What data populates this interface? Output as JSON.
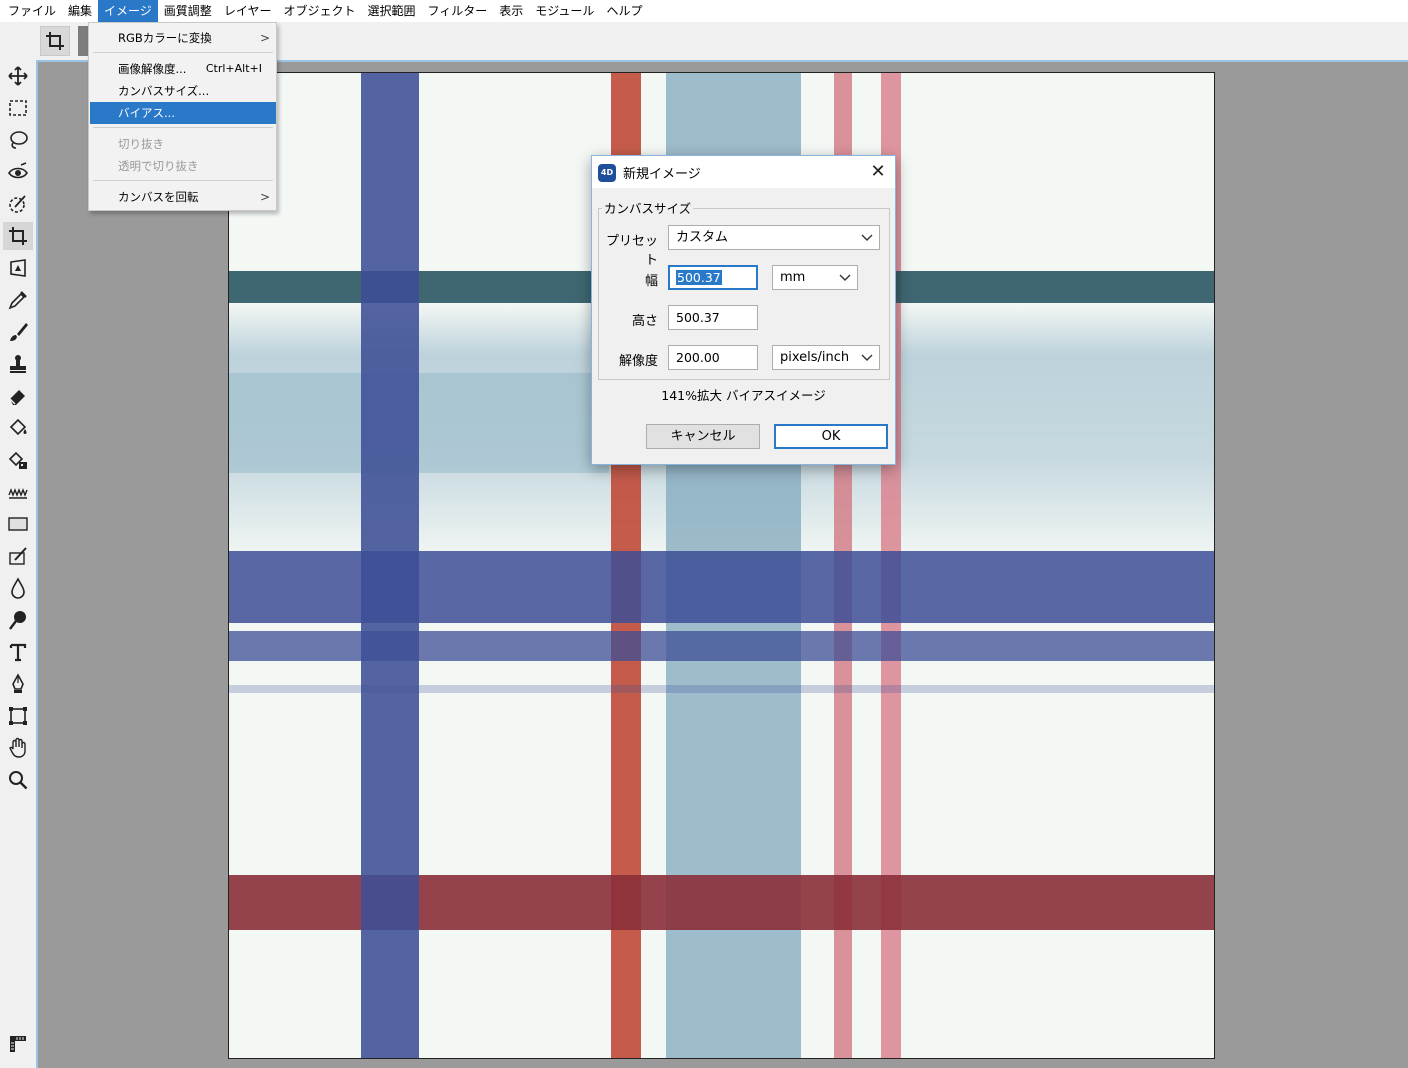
{
  "menubar": {
    "items": [
      "ファイル",
      "編集",
      "イメージ",
      "画質調整",
      "レイヤー",
      "オブジェクト",
      "選択範囲",
      "フィルター",
      "表示",
      "モジュール",
      "ヘルプ"
    ]
  },
  "image_menu": {
    "items": [
      {
        "label": "RGBカラーに変換",
        "shortcut": "",
        "submenu": true,
        "state": "normal"
      },
      {
        "label": "画像解像度...",
        "shortcut": "Ctrl+Alt+I",
        "submenu": false,
        "state": "normal"
      },
      {
        "label": "カンバスサイズ...",
        "shortcut": "",
        "submenu": false,
        "state": "normal"
      },
      {
        "label": "バイアス...",
        "shortcut": "",
        "submenu": false,
        "state": "highlighted"
      },
      {
        "label": "切り抜き",
        "shortcut": "",
        "submenu": false,
        "state": "disabled"
      },
      {
        "label": "透明で切り抜き",
        "shortcut": "",
        "submenu": false,
        "state": "disabled"
      },
      {
        "label": "カンバスを回転",
        "shortcut": "",
        "submenu": true,
        "state": "normal"
      }
    ]
  },
  "dialog": {
    "title": "新規イメージ",
    "close": "✕",
    "app_icon_text": "4D",
    "group_label": "カンバスサイズ",
    "preset_label": "プリセット",
    "preset_value": "カスタム",
    "width_label": "幅",
    "width_value": "500.37",
    "width_unit": "mm",
    "height_label": "高さ",
    "height_value": "500.37",
    "resolution_label": "解像度",
    "resolution_value": "200.00",
    "resolution_unit": "pixels/inch",
    "info": "141%拡大 バイアスイメージ",
    "cancel": "キャンセル",
    "ok": "OK"
  },
  "toolbar": {
    "tools": [
      "move",
      "rect-select",
      "lasso",
      "red-eye",
      "quick-select",
      "crop",
      "perspective",
      "eyedropper",
      "brush",
      "clone-stamp",
      "eraser",
      "fill",
      "gradient-fill",
      "wave",
      "rectangle",
      "retouch",
      "blur",
      "dodge",
      "text",
      "pen",
      "transform",
      "hand",
      "zoom",
      "ruler"
    ],
    "active_tool": "crop"
  },
  "colors": {
    "accent": "#2a78c8",
    "workspace": "#9a9a9a",
    "navy_stripe": "#3d4e96",
    "teal_stripe": "#2e5a66",
    "light_blue_stripe": "#8fb3c6",
    "rust_stripe": "#c04a38",
    "pink_stripe": "#d9848f",
    "maroon_stripe": "#8a2f3a"
  }
}
